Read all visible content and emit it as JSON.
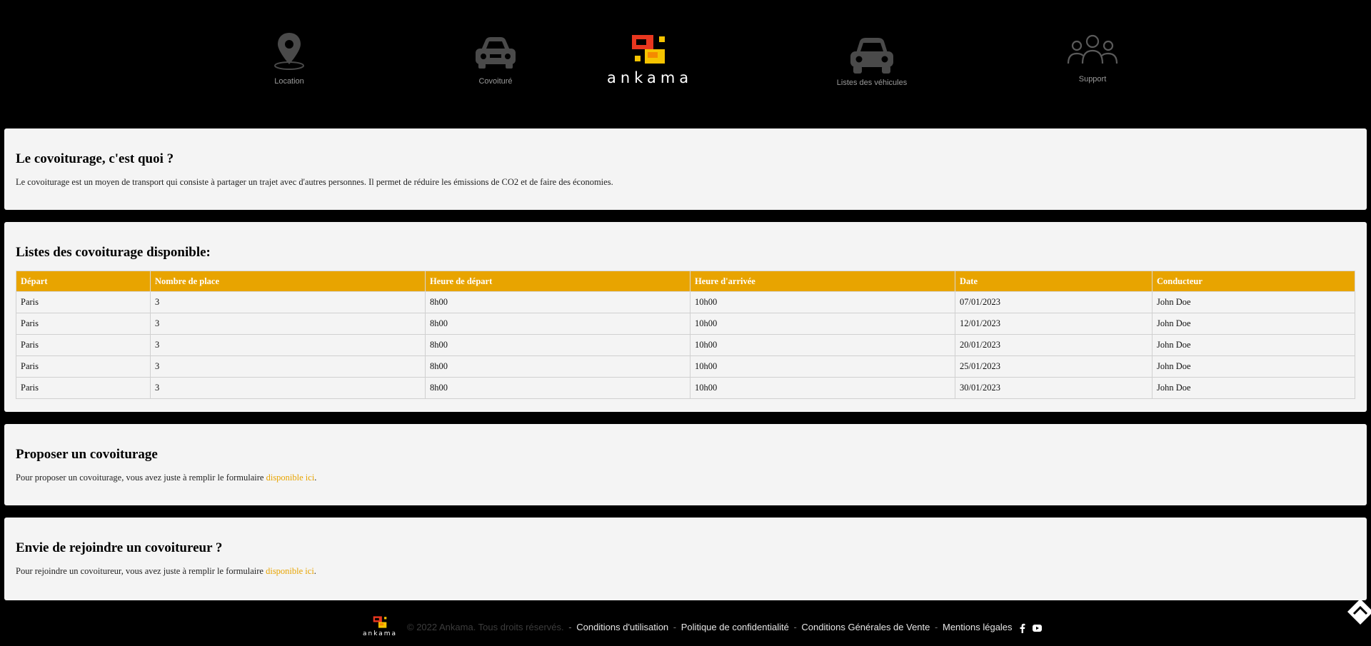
{
  "nav": {
    "location_label": "Location",
    "covoiture_label": "Covoituré",
    "vehicles_label": "Listes des véhicules",
    "support_label": "Support",
    "logo_text": "ankama"
  },
  "intro": {
    "title": "Le covoiturage, c'est quoi ?",
    "text": "Le covoiturage est un moyen de transport qui consiste à partager un trajet avec d'autres personnes. Il permet de réduire les émissions de CO2 et de faire des économies."
  },
  "list": {
    "title": "Listes des covoiturage disponible:",
    "headers": [
      "Départ",
      "Nombre de place",
      "Heure de départ",
      "Heure d'arrivée",
      "Date",
      "Conducteur"
    ],
    "rows": [
      [
        "Paris",
        "3",
        "8h00",
        "10h00",
        "07/01/2023",
        "John Doe"
      ],
      [
        "Paris",
        "3",
        "8h00",
        "10h00",
        "12/01/2023",
        "John Doe"
      ],
      [
        "Paris",
        "3",
        "8h00",
        "10h00",
        "20/01/2023",
        "John Doe"
      ],
      [
        "Paris",
        "3",
        "8h00",
        "10h00",
        "25/01/2023",
        "John Doe"
      ],
      [
        "Paris",
        "3",
        "8h00",
        "10h00",
        "30/01/2023",
        "John Doe"
      ]
    ]
  },
  "propose": {
    "title": "Proposer un covoiturage",
    "text_before": "Pour proposer un covoiturage, vous avez juste à remplir le formulaire ",
    "link": "disponible ici",
    "text_after": "."
  },
  "join": {
    "title": "Envie de rejoindre un covoitureur ?",
    "text_before": "Pour rejoindre un covoitureur, vous avez juste à remplir le formulaire ",
    "link": "disponible ici",
    "text_after": "."
  },
  "footer": {
    "logo_text": "ankama",
    "copyright": "© 2022 Ankama. Tous droits réservés.",
    "sep": "-",
    "links": [
      "Conditions d'utilisation",
      "Politique de confidentialité",
      "Conditions Générales de Vente",
      "Mentions légales"
    ],
    "social_icons": [
      "facebook-icon",
      "youtube-icon"
    ]
  },
  "colors": {
    "accent": "#e8a400",
    "background": "#000000",
    "card": "#f4f4f4",
    "logo_red": "#e8371f",
    "logo_yellow": "#f5c300"
  }
}
